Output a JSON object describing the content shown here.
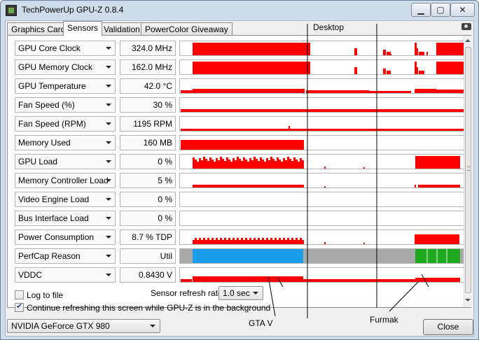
{
  "window": {
    "title": "TechPowerUp GPU-Z 0.8.4",
    "minimize_glyph": "▁",
    "maximize_glyph": "▢",
    "close_glyph": "✕"
  },
  "tabs": [
    {
      "label": "Graphics Card",
      "active": false
    },
    {
      "label": "Sensors",
      "active": true
    },
    {
      "label": "Validation",
      "active": false
    },
    {
      "label": "PowerColor Giveaway",
      "active": false
    }
  ],
  "colors": {
    "graph_red": "#ff0000",
    "perfcap_blue": "#1a9eea",
    "perfcap_gray": "#a8a8a8",
    "perfcap_green": "#1ea81e"
  },
  "sensors": [
    {
      "name": "GPU Core Clock",
      "value": "324.0 MHz"
    },
    {
      "name": "GPU Memory Clock",
      "value": "162.0 MHz"
    },
    {
      "name": "GPU Temperature",
      "value": "42.0 °C"
    },
    {
      "name": "Fan Speed (%)",
      "value": "30 %"
    },
    {
      "name": "Fan Speed (RPM)",
      "value": "1195 RPM"
    },
    {
      "name": "Memory Used",
      "value": "160 MB"
    },
    {
      "name": "GPU Load",
      "value": "0 %"
    },
    {
      "name": "Memory Controller Load",
      "value": "5 %"
    },
    {
      "name": "Video Engine Load",
      "value": "0 %"
    },
    {
      "name": "Bus Interface Load",
      "value": "0 %"
    },
    {
      "name": "Power Consumption",
      "value": "8.7 % TDP"
    },
    {
      "name": "PerfCap Reason",
      "value": "Util"
    },
    {
      "name": "VDDC",
      "value": "0.8430 V"
    }
  ],
  "options": {
    "log_to_file_label": "Log to file",
    "log_to_file_checked": false,
    "refresh_rate_label": "Sensor refresh rate:",
    "refresh_rate_value": "1.0 sec",
    "background_label": "Continue refreshing this screen while GPU-Z is in the background",
    "background_checked": true
  },
  "gpu_select": {
    "value": "NVIDIA GeForce GTX 980"
  },
  "close_button": {
    "label": "Close"
  },
  "annotations": {
    "desktop": "Desktop",
    "gta": "GTA V",
    "furmak": "Furmak"
  }
}
